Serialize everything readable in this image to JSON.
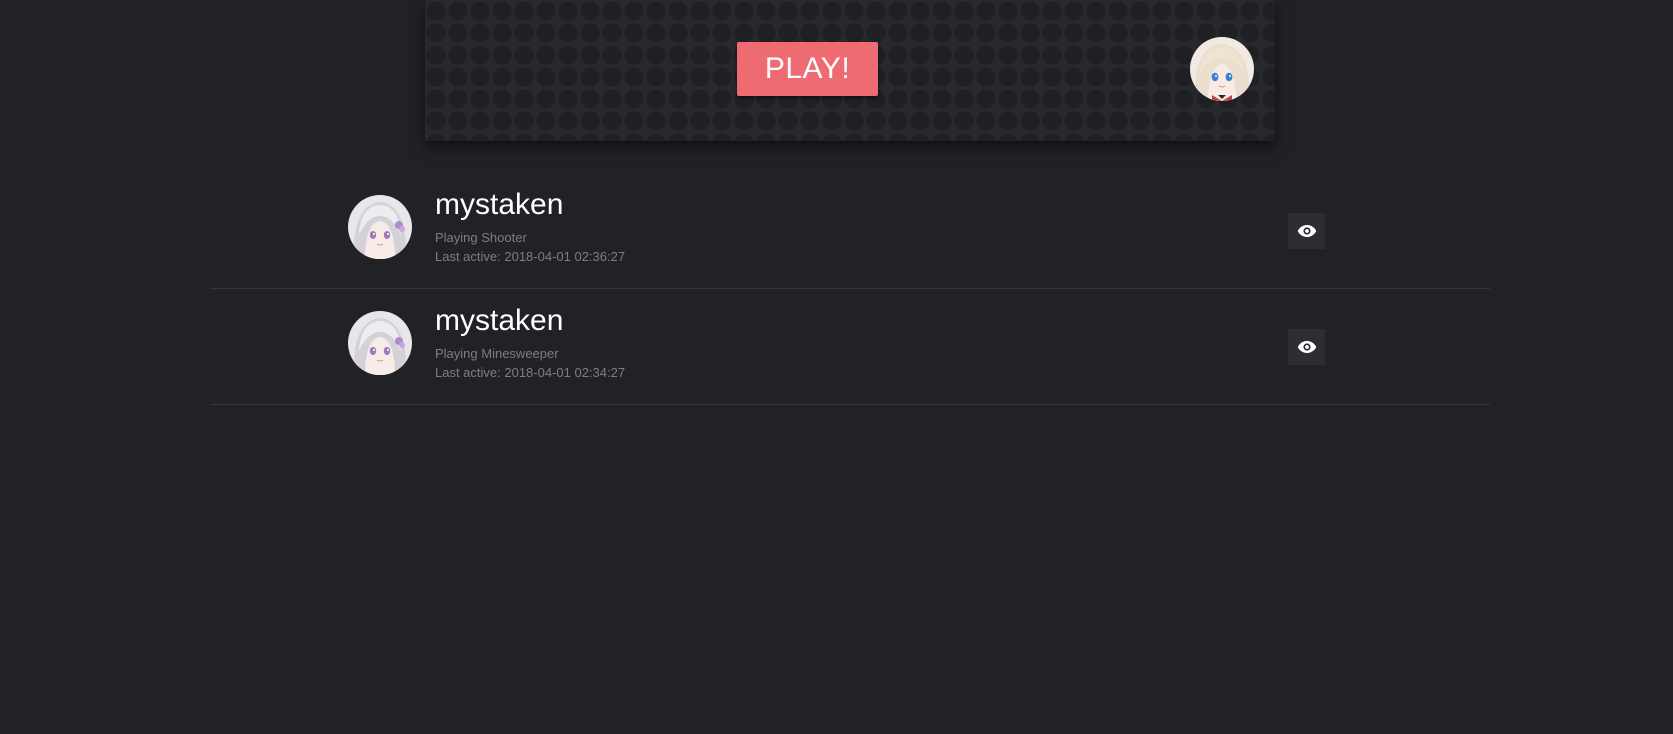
{
  "header": {
    "play_label": "PLAY!",
    "play_color": "#ef6b72",
    "user_avatar_icon": "anime-avatar-blonde"
  },
  "players": [
    {
      "name": "mystaken",
      "status": "Playing Shooter",
      "last_active": "Last active: 2018-04-01 02:36:27",
      "avatar_icon": "anime-avatar-silver",
      "action_icon": "eye-icon"
    },
    {
      "name": "mystaken",
      "status": "Playing Minesweeper",
      "last_active": "Last active: 2018-04-01 02:34:27",
      "avatar_icon": "anime-avatar-silver",
      "action_icon": "eye-icon"
    }
  ]
}
